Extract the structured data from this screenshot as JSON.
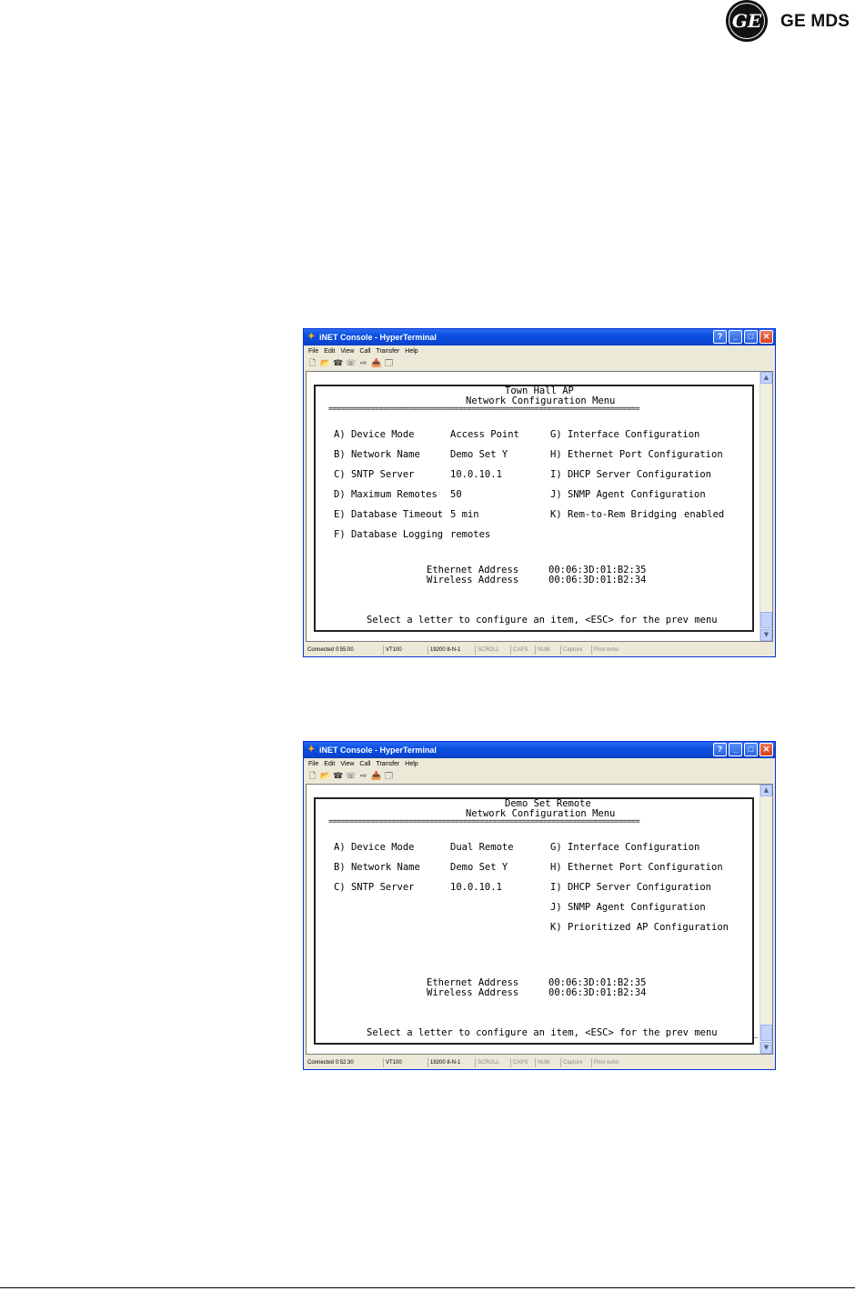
{
  "logo": {
    "mark": "GE",
    "text": "GE MDS"
  },
  "windows": [
    {
      "title": "iNET Console - HyperTerminal",
      "menus": [
        "File",
        "Edit",
        "View",
        "Call",
        "Transfer",
        "Help"
      ],
      "terminal": {
        "header1": "Town Hall AP",
        "header2": "Network Configuration Menu",
        "rule": "==========================================================================",
        "left": [
          {
            "key": "A) Device Mode",
            "value": "Access Point"
          },
          {
            "key": "B) Network Name",
            "value": "Demo Set Y"
          },
          {
            "key": "C) SNTP Server",
            "value": "10.0.10.1"
          },
          {
            "key": "D) Maximum Remotes",
            "value": "50"
          },
          {
            "key": "E) Database Timeout",
            "value": "5 min"
          },
          {
            "key": "F) Database Logging",
            "value": "remotes"
          }
        ],
        "right": [
          {
            "key": "G) Interface Configuration",
            "value": ""
          },
          {
            "key": "H) Ethernet Port Configuration",
            "value": ""
          },
          {
            "key": "I) DHCP Server Configuration",
            "value": ""
          },
          {
            "key": "J) SNMP Agent Configuration",
            "value": ""
          },
          {
            "key": "K) Rem-to-Rem Bridging",
            "value": "enabled"
          }
        ],
        "eth_label": "Ethernet Address",
        "eth_value": "00:06:3D:01:B2:35",
        "wl_label": "Wireless Address",
        "wl_value": "00:06:3D:01:B2:34",
        "prompt": "Select a letter to configure an item, <ESC> for the prev menu",
        "cursor": ""
      },
      "status": [
        "Connected 0:55:00",
        "VT100",
        "19200 8-N-1",
        "SCROLL",
        "CAPS",
        "NUM",
        "Capture",
        "Print echo"
      ]
    },
    {
      "title": "iNET Console - HyperTerminal",
      "menus": [
        "File",
        "Edit",
        "View",
        "Call",
        "Transfer",
        "Help"
      ],
      "terminal": {
        "header1": "Demo Set Remote",
        "header2": "Network Configuration Menu",
        "rule": "==========================================================================",
        "left": [
          {
            "key": "A) Device Mode",
            "value": "Dual Remote"
          },
          {
            "key": "B) Network Name",
            "value": "Demo Set Y"
          },
          {
            "key": "C) SNTP Server",
            "value": "10.0.10.1"
          }
        ],
        "right": [
          {
            "key": "G) Interface Configuration",
            "value": ""
          },
          {
            "key": "H) Ethernet Port Configuration",
            "value": ""
          },
          {
            "key": "I) DHCP Server Configuration",
            "value": ""
          },
          {
            "key": "J) SNMP Agent Configuration",
            "value": ""
          },
          {
            "key": "K) Prioritized AP Configuration",
            "value": ""
          }
        ],
        "eth_label": "Ethernet Address",
        "eth_value": "00:06:3D:01:B2:35",
        "wl_label": "Wireless Address",
        "wl_value": "00:06:3D:01:B2:34",
        "prompt": "Select a letter to configure an item, <ESC> for the prev menu",
        "cursor": "_"
      },
      "status": [
        "Connected 0:52:30",
        "VT100",
        "19200 8-N-1",
        "SCROLL",
        "CAPS",
        "NUM",
        "Capture",
        "Print echo"
      ]
    }
  ]
}
